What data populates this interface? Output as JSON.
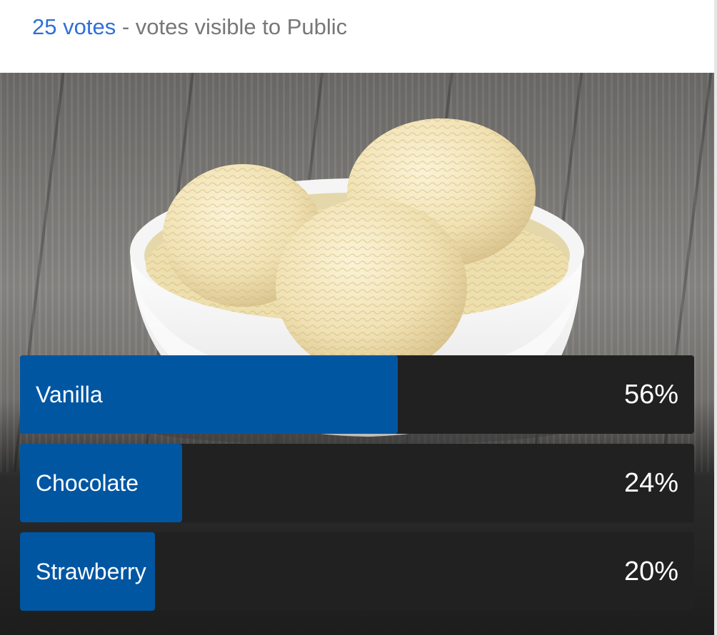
{
  "header": {
    "votes_text": "25 votes",
    "separator": "-",
    "visibility_text": "votes visible to Public"
  },
  "photo": {
    "icon": "ice-cream-bowl-photo"
  },
  "poll": {
    "options": [
      {
        "label": "Vanilla",
        "percent_text": "56%",
        "percent": 56
      },
      {
        "label": "Chocolate",
        "percent_text": "24%",
        "percent": 24
      },
      {
        "label": "Strawberry",
        "percent_text": "20%",
        "percent": 20
      }
    ]
  },
  "colors": {
    "link": "#2f6fd8",
    "muted_text": "#777777",
    "bar_fill": "#0156a2",
    "bar_track": "#212121",
    "bar_text": "#ffffff"
  }
}
